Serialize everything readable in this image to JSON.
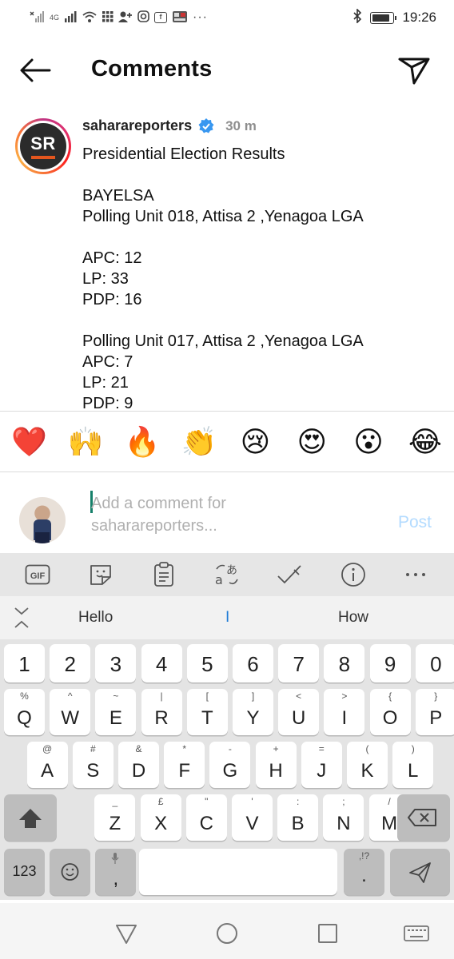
{
  "status_bar": {
    "left_network": "4G",
    "time": "19:26",
    "icons": [
      "signal-icon",
      "wifi-icon",
      "grid-icon",
      "add-person-icon",
      "instagram-icon",
      "facebook-icon",
      "news-icon",
      "more-icon"
    ],
    "battery_level": 0.85
  },
  "header": {
    "title": "Comments"
  },
  "post": {
    "username": "saharareporters",
    "time": "30 m",
    "avatar_text": "SR",
    "lines": [
      "Presidential Election Results",
      "",
      "BAYELSA",
      "Polling Unit 018, Attisa 2 ,Yenagoa LGA",
      "",
      "APC: 12",
      "LP: 33",
      "PDP: 16",
      "",
      "Polling Unit 017, Attisa 2 ,Yenagoa LGA",
      "APC: 7",
      "LP: 21",
      "PDP: 9"
    ]
  },
  "emoji_reactions": [
    {
      "char": "❤️",
      "name": "heart"
    },
    {
      "char": "🙌",
      "name": "raised-hands"
    },
    {
      "char": "🔥",
      "name": "fire"
    },
    {
      "char": "👏",
      "name": "clapping-hands"
    },
    {
      "char": "😢",
      "name": "crying-face"
    },
    {
      "char": "😍",
      "name": "heart-eyes"
    },
    {
      "char": "😮",
      "name": "surprised-face"
    },
    {
      "char": "😂",
      "name": "tears-of-joy"
    }
  ],
  "comment": {
    "placeholder_line1": "Add a comment for",
    "placeholder_line2": "saharareporters...",
    "post_label": "Post"
  },
  "suggestions": {
    "left": "Hello",
    "middle": "I",
    "right": "How"
  },
  "keyboard": {
    "numbers": [
      "1",
      "2",
      "3",
      "4",
      "5",
      "6",
      "7",
      "8",
      "9",
      "0"
    ],
    "row1": [
      [
        "Q",
        "%"
      ],
      [
        "W",
        "^"
      ],
      [
        "E",
        "~"
      ],
      [
        "R",
        "|"
      ],
      [
        "T",
        "["
      ],
      [
        "Y",
        "]"
      ],
      [
        "U",
        "<"
      ],
      [
        "I",
        ">"
      ],
      [
        "O",
        "{"
      ],
      [
        "P",
        "}"
      ]
    ],
    "row2": [
      [
        "A",
        "@"
      ],
      [
        "S",
        "#"
      ],
      [
        "D",
        "&"
      ],
      [
        "F",
        "*"
      ],
      [
        "G",
        "-"
      ],
      [
        "H",
        "+"
      ],
      [
        "J",
        "="
      ],
      [
        "K",
        "("
      ],
      [
        "L",
        ")"
      ]
    ],
    "row3": [
      [
        "Z",
        "_"
      ],
      [
        "X",
        "£"
      ],
      [
        "C",
        "\""
      ],
      [
        "V",
        "'"
      ],
      [
        "B",
        ":"
      ],
      [
        "N",
        ";"
      ],
      [
        "M",
        "/"
      ]
    ],
    "symbols_key": "123",
    "comma_key": ",",
    "period_key": ".",
    "period_sub": ",!?"
  }
}
